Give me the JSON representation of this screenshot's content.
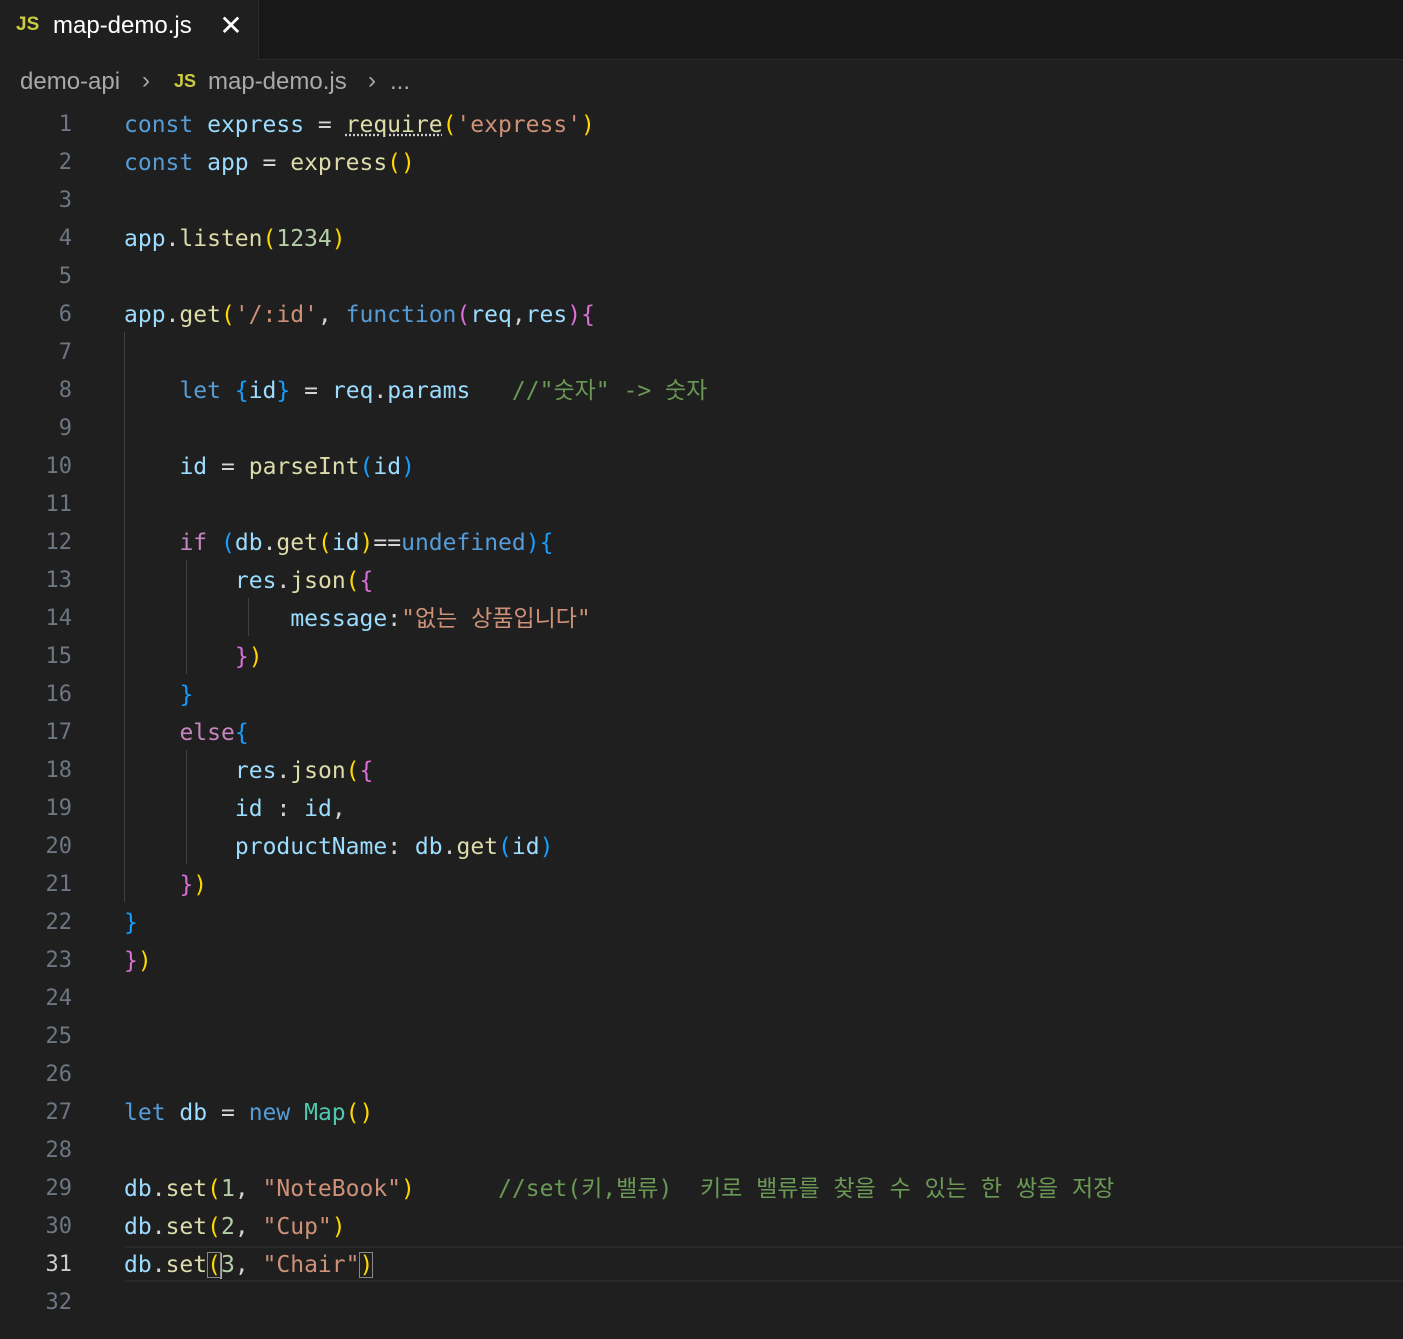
{
  "tab": {
    "icon": "javascript-file-icon",
    "badge": "JS",
    "title": "map-demo.js",
    "close": "✕"
  },
  "breadcrumb": {
    "folder": "demo-api",
    "file_badge": "JS",
    "file": "map-demo.js",
    "more": "...",
    "separator": "›"
  },
  "editor": {
    "active_line": 31,
    "line_numbers": [
      "1",
      "2",
      "3",
      "4",
      "5",
      "6",
      "7",
      "8",
      "9",
      "10",
      "11",
      "12",
      "13",
      "14",
      "15",
      "16",
      "17",
      "18",
      "19",
      "20",
      "21",
      "22",
      "23",
      "24",
      "25",
      "26",
      "27",
      "28",
      "29",
      "30",
      "31",
      "32"
    ],
    "lines": [
      "const express = require('express')",
      "const app = express()",
      "",
      "app.listen(1234)",
      "",
      "app.get('/:id', function(req,res){",
      "",
      "    let {id} = req.params   //\"숫자\" -> 숫자",
      "",
      "    id = parseInt(id)",
      "",
      "    if (db.get(id)==undefined){",
      "        res.json({",
      "            message:\"없는 상품입니다\"",
      "        })",
      "    }",
      "    else{",
      "        res.json({",
      "        id : id,",
      "        productName: db.get(id)",
      "    })",
      "}",
      "})",
      "",
      "",
      "",
      "let db = new Map()",
      "",
      "db.set(1, \"NoteBook\")      //set(키,밸류)  키로 밸류를 찾을 수 있는 한 쌍을 저장",
      "db.set(2, \"Cup\")",
      "db.set(3, \"Chair\")",
      ""
    ]
  },
  "colors": {
    "background": "#1f1f1f",
    "keyword": "#569cd6",
    "control": "#c586c0",
    "variable": "#9cdcfe",
    "function": "#dcdcaa",
    "string": "#ce9178",
    "number": "#b5cea8",
    "comment": "#6a9955",
    "class": "#4ec9b0"
  }
}
